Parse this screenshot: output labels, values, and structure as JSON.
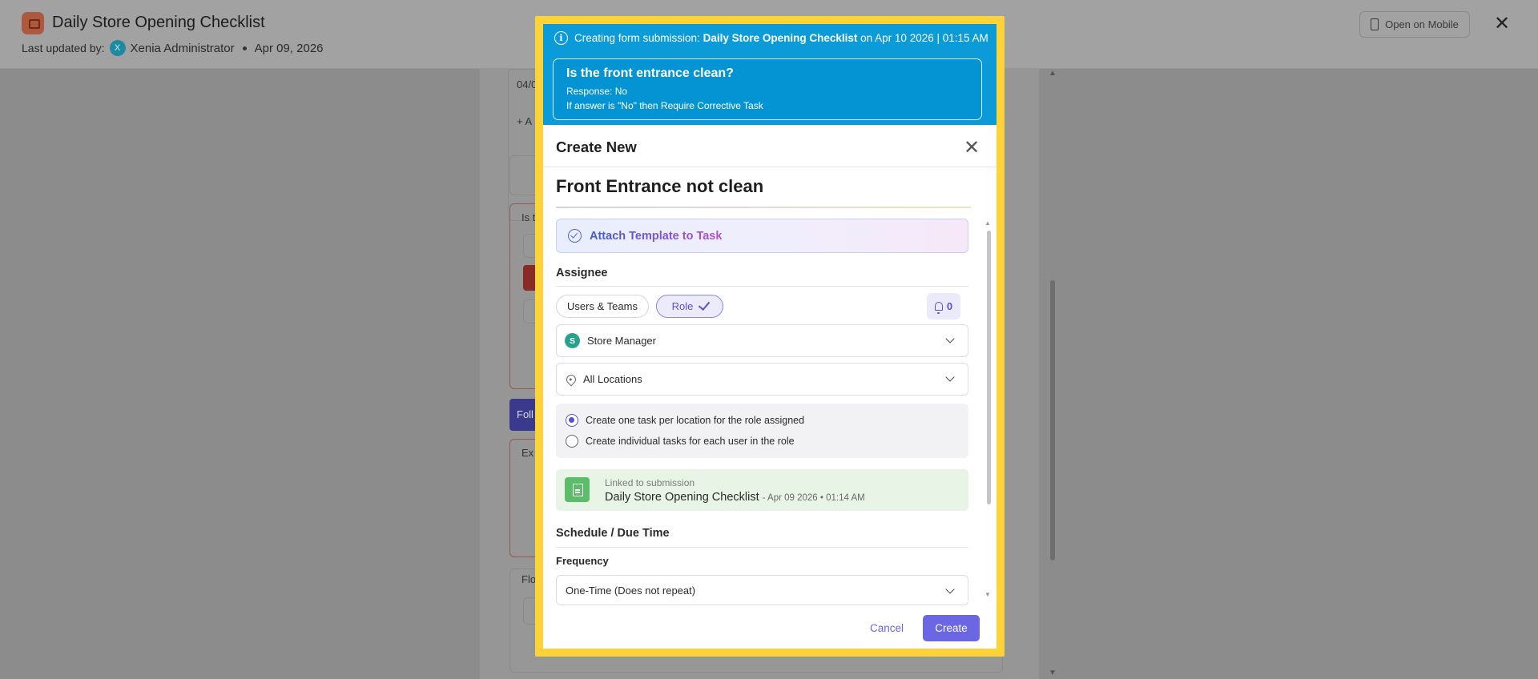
{
  "page": {
    "title": "Daily Store Opening Checklist",
    "updated_label": "Last updated by:",
    "updated_avatar": "X",
    "updated_user": "Xenia Administrator",
    "updated_date": "Apr 09, 2026",
    "open_mobile_label": "Open on Mobile"
  },
  "background_form": {
    "date_stub": "04/0",
    "add_stub": "+ A",
    "is_stub": "Is t",
    "follow_stub": "Foll",
    "ex_stub": "Ex",
    "flo_stub": "Flo"
  },
  "modal": {
    "banner": {
      "prefix": "Creating form submission:",
      "form_name": "Daily Store Opening Checklist",
      "suffix": "on Apr 10 2026 | 01:15 AM"
    },
    "question": {
      "title": "Is the front entrance clean?",
      "response": "Response: No",
      "rule": "If answer is \"No\" then Require Corrective Task"
    },
    "header": "Create New",
    "task_title": "Front Entrance not clean",
    "attach_label": "Attach Template to Task",
    "assignee": {
      "label": "Assignee",
      "tab_users": "Users & Teams",
      "tab_role": "Role",
      "notify_count": "0",
      "role_avatar": "S",
      "role_value": "Store Manager",
      "location_value": "All Locations",
      "options": [
        {
          "label": "Create one task per location for the role assigned",
          "selected": true
        },
        {
          "label": "Create individual tasks for each user in the role",
          "selected": false
        }
      ]
    },
    "linked": {
      "label": "Linked to submission",
      "name": "Daily Store Opening Checklist",
      "date": "Apr 09 2026 • 01:14 AM"
    },
    "schedule": {
      "label": "Schedule / Due Time",
      "frequency_label": "Frequency",
      "frequency_value": "One-Time (Does not repeat)"
    },
    "footer": {
      "cancel": "Cancel",
      "create": "Create"
    }
  },
  "colors": {
    "highlight_frame": "#fdd33a",
    "banner": "#0b9bd9",
    "accent": "#6b66e3"
  }
}
